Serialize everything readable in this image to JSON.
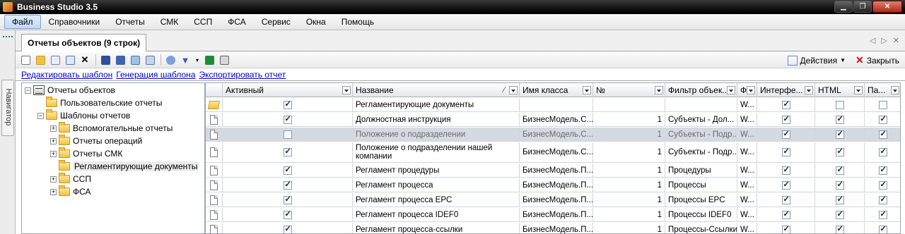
{
  "window": {
    "title": "Business Studio 3.5"
  },
  "menu": [
    "Файл",
    "Справочники",
    "Отчеты",
    "СМК",
    "ССП",
    "ФСА",
    "Сервис",
    "Окна",
    "Помощь"
  ],
  "navigator": {
    "label": "Навигатор"
  },
  "doc_tab": {
    "title": "Отчеты объектов (9 строк)"
  },
  "toolbar": {
    "actions_label": "Действия",
    "close_label": "Закрыть"
  },
  "links": [
    "Редактировать шаблон",
    "Генерация шаблона",
    "Экспортировать отчет"
  ],
  "tree": {
    "root": "Отчеты объектов",
    "user_reports": "Пользовательские отчеты",
    "templates": "Шаблоны отчетов",
    "children": [
      "Вспомогательные отчеты",
      "Отчеты операций",
      "Отчеты СМК",
      "Регламентирующие документы",
      "ССП",
      "ФСА"
    ]
  },
  "grid": {
    "columns": [
      "Активный",
      "Название",
      "Имя класса",
      "№",
      "Фильтр объек...",
      "Ф",
      "Интерфе...",
      "HTML",
      "Па..."
    ],
    "rows": [
      {
        "name": "Регламентирующие документы",
        "class": "",
        "num": "",
        "filter": "",
        "f": "W...",
        "active": true,
        "iface": true,
        "html": false,
        "pa": false,
        "type": "folder"
      },
      {
        "name": "Должностная инструкция",
        "class": "БизнесМодель.С...",
        "num": "1",
        "filter": "Субъекты - Дол...",
        "f": "W...",
        "active": true,
        "iface": true,
        "html": true,
        "pa": true,
        "type": "doc"
      },
      {
        "name": "Положение о подразделении",
        "class": "БизнесМодель.С...",
        "num": "1",
        "filter": "Субъекты - Подр...",
        "f": "W...",
        "active": false,
        "iface": true,
        "html": true,
        "pa": true,
        "type": "doc"
      },
      {
        "name": "Положение о подразделении нашей компании",
        "class": "БизнесМодель.С...",
        "num": "1",
        "filter": "Субъекты - Подр...",
        "f": "W...",
        "active": true,
        "iface": true,
        "html": true,
        "pa": true,
        "type": "doc"
      },
      {
        "name": "Регламент процедуры",
        "class": "БизнесМодель.П...",
        "num": "1",
        "filter": "Процедуры",
        "f": "W...",
        "active": true,
        "iface": true,
        "html": true,
        "pa": true,
        "type": "doc"
      },
      {
        "name": "Регламент процесса",
        "class": "БизнесМодель.П...",
        "num": "1",
        "filter": "Процессы",
        "f": "W...",
        "active": true,
        "iface": true,
        "html": true,
        "pa": true,
        "type": "doc"
      },
      {
        "name": "Регламент процесса EPC",
        "class": "БизнесМодель.П...",
        "num": "1",
        "filter": "Процессы EPC",
        "f": "W...",
        "active": true,
        "iface": true,
        "html": true,
        "pa": true,
        "type": "doc"
      },
      {
        "name": "Регламент процесса IDEF0",
        "class": "БизнесМодель.П...",
        "num": "1",
        "filter": "Процессы IDEF0",
        "f": "W...",
        "active": true,
        "iface": true,
        "html": true,
        "pa": true,
        "type": "doc"
      },
      {
        "name": "Регламент процесса-ссылки",
        "class": "БизнесМодель.П...",
        "num": "1",
        "filter": "Процессы-Ссылки",
        "f": "W...",
        "active": true,
        "iface": true,
        "html": true,
        "pa": true,
        "type": "doc"
      }
    ]
  }
}
